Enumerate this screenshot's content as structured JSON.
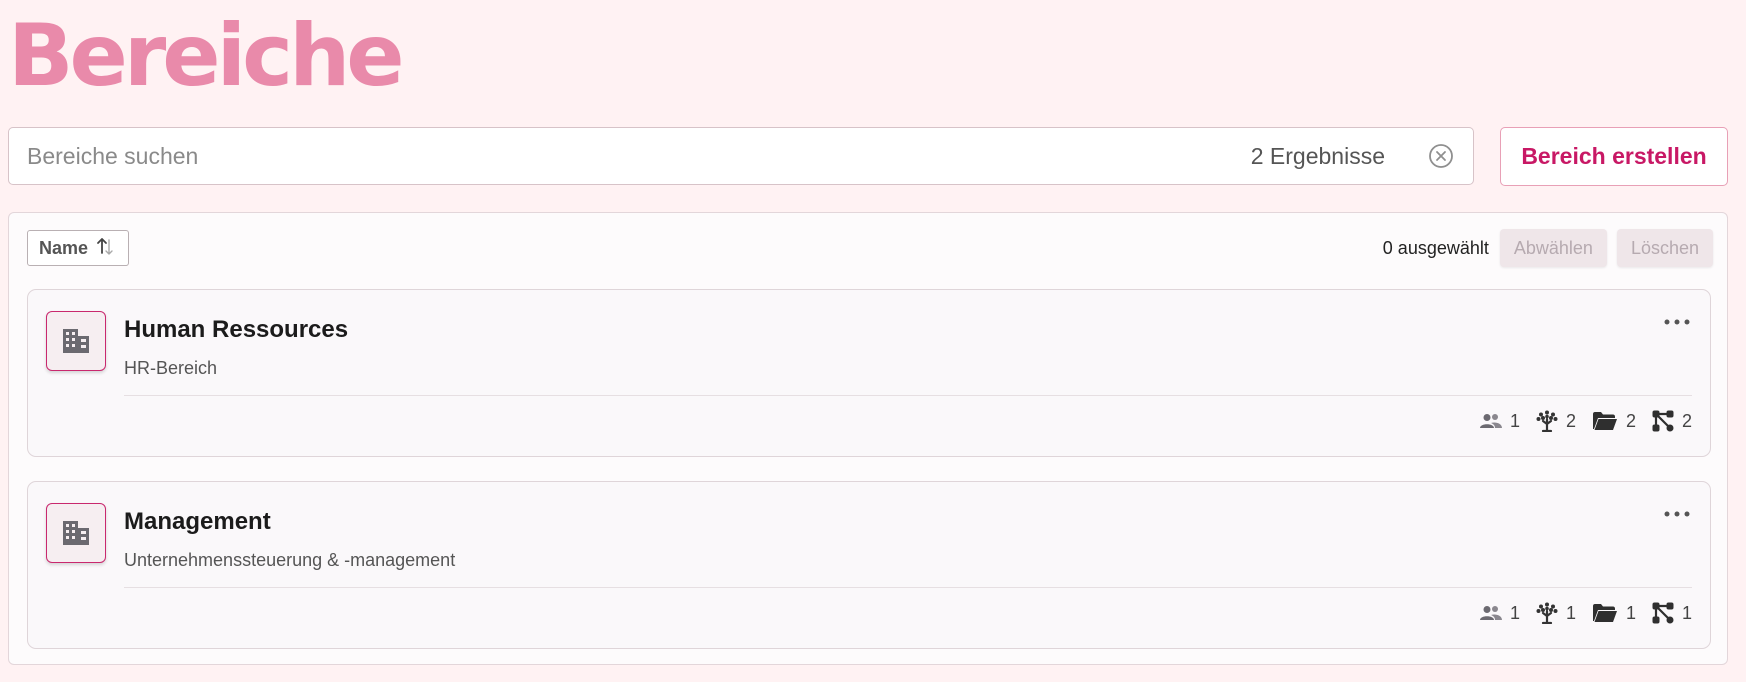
{
  "page": {
    "title": "Bereiche"
  },
  "search": {
    "placeholder": "Bereiche suchen",
    "value": "",
    "result_count": "2 Ergebnisse"
  },
  "actions": {
    "create_label": "Bereich erstellen"
  },
  "toolbar": {
    "sort_label": "Name",
    "selected_text": "0 ausgewählt",
    "deselect_label": "Abwählen",
    "delete_label": "Löschen"
  },
  "areas": [
    {
      "name": "Human Ressources",
      "description": "HR-Bereich",
      "stats": {
        "members": "1",
        "trees": "2",
        "folders": "2",
        "processes": "2"
      }
    },
    {
      "name": "Management",
      "description": "Unternehmenssteuerung & -management",
      "stats": {
        "members": "1",
        "trees": "1",
        "folders": "1",
        "processes": "1"
      }
    }
  ],
  "colors": {
    "accent": "#c81865",
    "title": "#e98aaa",
    "background": "#fff2f3"
  }
}
